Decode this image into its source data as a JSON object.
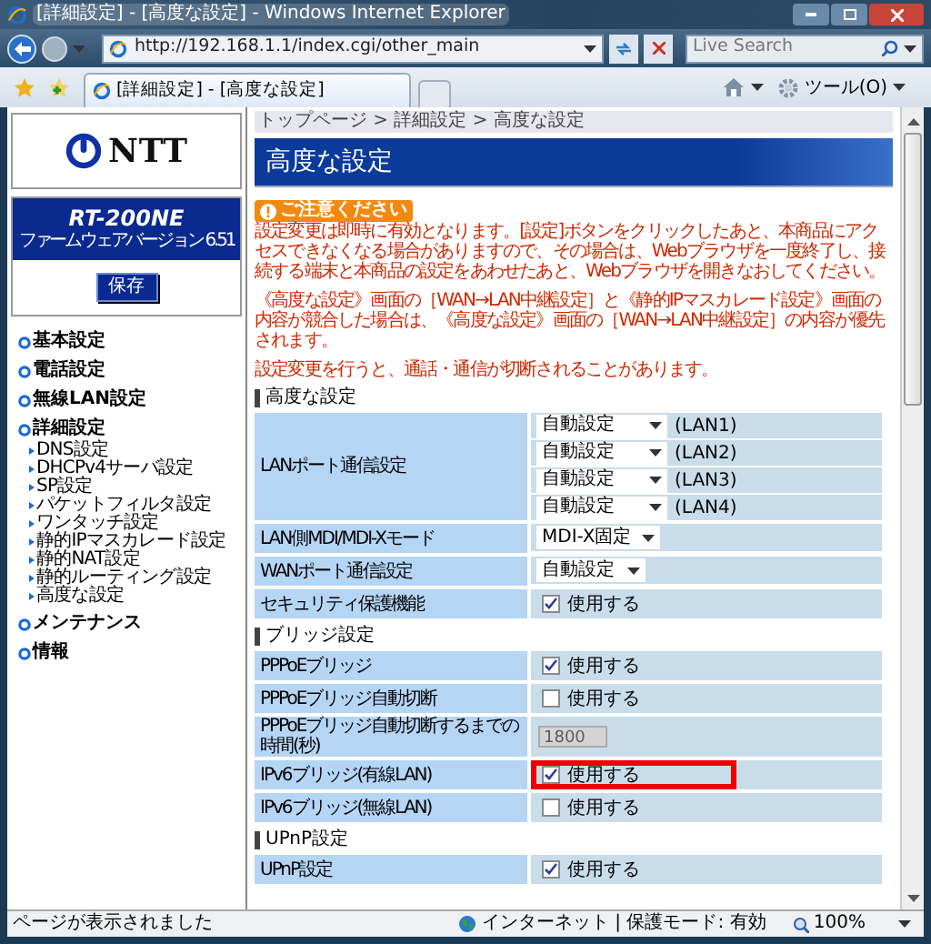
{
  "window": {
    "title": "[詳細設定] - [高度な設定] - Windows Internet Explorer"
  },
  "address_bar": {
    "url": "http://192.168.1.1/index.cgi/other_main"
  },
  "search": {
    "placeholder": "Live Search"
  },
  "tab": {
    "title": "[詳細設定] - [高度な設定]"
  },
  "tools_menu": {
    "label": "ツール(O)"
  },
  "sidebar": {
    "logo": "NTT",
    "model": "RT-200NE",
    "firmware": "ファームウェアバージョン 6.51",
    "save_button": "保存",
    "nav": [
      {
        "label": "基本設定"
      },
      {
        "label": "電話設定"
      },
      {
        "label": "無線LAN設定"
      },
      {
        "label": "詳細設定",
        "children": [
          {
            "label": "DNS設定"
          },
          {
            "label": "DHCPv4サーバ設定"
          },
          {
            "label": "SP設定"
          },
          {
            "label": "パケットフィルタ設定"
          },
          {
            "label": "ワンタッチ設定"
          },
          {
            "label": "静的IPマスカレード設定"
          },
          {
            "label": "静的NAT設定"
          },
          {
            "label": "静的ルーティング設定"
          },
          {
            "label": "高度な設定"
          }
        ]
      },
      {
        "label": "メンテナンス"
      },
      {
        "label": "情報"
      }
    ]
  },
  "breadcrumb": "トップページ > 詳細設定 > 高度な設定",
  "page_title": "高度な設定",
  "notice": {
    "badge": "ご注意ください",
    "paragraphs": [
      "設定変更は即時に有効となります。[設定]ボタンをクリックしたあと、本商品にアクセスできなくなる場合がありますので、その場合は、Webブラウザを一度終了し、接続する端末と本商品の設定をあわせたあと、Webブラウザを開きなおしてください。",
      "《高度な設定》画面の［WAN→LAN中継設定］と《静的IPマスカレード設定》画面の内容が競合した場合は、《高度な設定》画面の［WAN→LAN中継設定］の内容が優先されます。",
      "設定変更を行うと、通話・通信が切断されることがあります。"
    ]
  },
  "sections": [
    {
      "title": "高度な設定",
      "rows": [
        {
          "label": "LANポート通信設定",
          "kind": "selects",
          "selects": [
            {
              "value": "自動設定",
              "suffix": "(LAN1)"
            },
            {
              "value": "自動設定",
              "suffix": "(LAN2)"
            },
            {
              "value": "自動設定",
              "suffix": "(LAN3)"
            },
            {
              "value": "自動設定",
              "suffix": "(LAN4)"
            }
          ]
        },
        {
          "label": "LAN側MDI/MDI-Xモード",
          "kind": "select",
          "value": "MDI-X固定"
        },
        {
          "label": "WANポート通信設定",
          "kind": "select",
          "value": "自動設定"
        },
        {
          "label": "セキュリティ保護機能",
          "kind": "checkbox",
          "checked": true,
          "option": "使用する"
        }
      ]
    },
    {
      "title": "ブリッジ設定",
      "rows": [
        {
          "label": "PPPoEブリッジ",
          "kind": "checkbox",
          "checked": true,
          "option": "使用する"
        },
        {
          "label": "PPPoEブリッジ自動切断",
          "kind": "checkbox",
          "checked": false,
          "option": "使用する"
        },
        {
          "label": "PPPoEブリッジ自動切断するまでの時間(秒)",
          "kind": "number",
          "value": "1800",
          "disabled": true
        },
        {
          "label": "IPv6ブリッジ(有線LAN)",
          "kind": "checkbox",
          "highlighted": true,
          "checked": true,
          "option": "使用する"
        },
        {
          "label": "IPv6ブリッジ(無線LAN)",
          "kind": "checkbox",
          "checked": false,
          "option": "使用する"
        }
      ]
    },
    {
      "title": "UPnP設定",
      "rows": [
        {
          "label": "UPnP設定",
          "kind": "checkbox",
          "checked": true,
          "option": "使用する"
        }
      ]
    }
  ],
  "status_bar": {
    "text": "ページが表示されました",
    "zone": "インターネット | 保護モード: 有効",
    "zoom": "100%"
  }
}
